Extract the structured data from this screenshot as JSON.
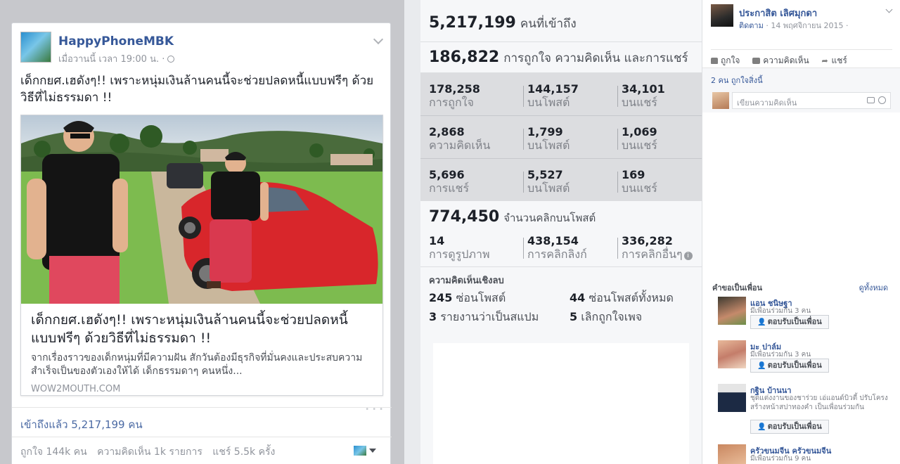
{
  "post": {
    "page_name": "HappyPhoneMBK",
    "time": "เมื่อวานนี้ เวลา 19:00 น. ·",
    "text": "เด็กกยศ.เฮดังๆ!! เพราะหนุ่มเงินล้านคนนี้จะช่วยปลดหนี้แบบฟรีๆ ด้วยวิธีที่ไม่ธรรมดา !!",
    "link": {
      "title": "เด็กกยศ.เฮดังๆ!! เพราะหนุ่มเงินล้านคนนี้จะช่วยปลดหนี้แบบฟรีๆ ด้วยวิธีที่ไม่ธรรมดา !!",
      "description": "จากเรื่องราวของเด็กหนุ่มที่มีความฝัน สักวันต้องมีธุรกิจที่มั่นคงและประสบความสำเร็จเป็นของตัวเองให้ได้ เด็กธรรมดาๆ คนหนึ่ง...",
      "domain": "WOW2MOUTH.COM"
    },
    "reach": "เข้าถึงแล้ว 5,217,199 คน",
    "summary": {
      "likes": "ถูกใจ 144k คน",
      "comments": "ความคิดเห็น 1k รายการ",
      "shares": "แชร์ 5.5k ครั้ง"
    }
  },
  "insights": {
    "reach_num": "5,217,199",
    "reach_label": "คนที่เข้าถึง",
    "engage_num": "186,822",
    "engage_label": "การถูกใจ ความคิดเห็น และการแชร์",
    "grid": [
      [
        {
          "n": "178,258",
          "l": "การถูกใจ"
        },
        {
          "n": "144,157",
          "l": "บนโพสต์"
        },
        {
          "n": "34,101",
          "l": "บนแชร์"
        }
      ],
      [
        {
          "n": "2,868",
          "l": "ความคิดเห็น"
        },
        {
          "n": "1,799",
          "l": "บนโพสต์"
        },
        {
          "n": "1,069",
          "l": "บนแชร์"
        }
      ],
      [
        {
          "n": "5,696",
          "l": "การแชร์"
        },
        {
          "n": "5,527",
          "l": "บนโพสต์"
        },
        {
          "n": "169",
          "l": "บนแชร์"
        }
      ]
    ],
    "clicks_num": "774,450",
    "clicks_label": "จำนวนคลิกบนโพสต์",
    "clicks": [
      {
        "n": "14",
        "l": "การดูรูปภาพ"
      },
      {
        "n": "438,154",
        "l": "การคลิกลิงก์"
      },
      {
        "n": "336,282",
        "l": "การคลิกอื่นๆ"
      }
    ],
    "negative_title": "ความคิดเห็นเชิงลบ",
    "negative": [
      {
        "n": "245",
        "l": "ซ่อนโพสต์"
      },
      {
        "n": "44",
        "l": "ซ่อนโพสต์ทั้งหมด"
      },
      {
        "n": "3",
        "l": "รายงานว่าเป็นสแปม"
      },
      {
        "n": "5",
        "l": "เลิกถูกใจเพจ"
      }
    ]
  },
  "profile_post": {
    "name": "ประกาสิต เลิศมุกดา",
    "follow": "ติดตาม",
    "date": " · 14 พฤศจิกายน 2015 ·",
    "actions": {
      "like": "ถูกใจ",
      "comment": "ความคิดเห็น",
      "share": "แชร์"
    },
    "likes_text": "2 คน ถูกใจสิ่งนี้",
    "comment_placeholder": "เขียนความคิดเห็น"
  },
  "friend_requests": {
    "title": "คำขอเป็นเพื่อน",
    "see_all": "ดูทั้งหมด",
    "confirm_label": "ตอบรับเป็นเพื่อน",
    "items": [
      {
        "name": "แอน ชนิษฐา",
        "mutual": "มีเพื่อนร่วมกัน 3 คน"
      },
      {
        "name": "มะ ปาล์ม",
        "mutual": "มีเพื่อนร่วมกัน 3 คน"
      },
      {
        "name": "กฐิน บ้านนา",
        "mutual": "ชุดแต่งงานของชาร่วย เอ่แอนด์บิวตี้ ปรับโครงสร้างหน้าสปาทองคำ เป็นเพื่อนร่วมกัน"
      },
      {
        "name": "ครัวขนมจีน ครัวขนมจีน",
        "mutual": "มีเพื่อนร่วมกัน 9 คน"
      }
    ]
  },
  "colors": {
    "link_blue": "#365899",
    "bg": "#e9ebee",
    "insights_grid": "#dcdde0"
  }
}
